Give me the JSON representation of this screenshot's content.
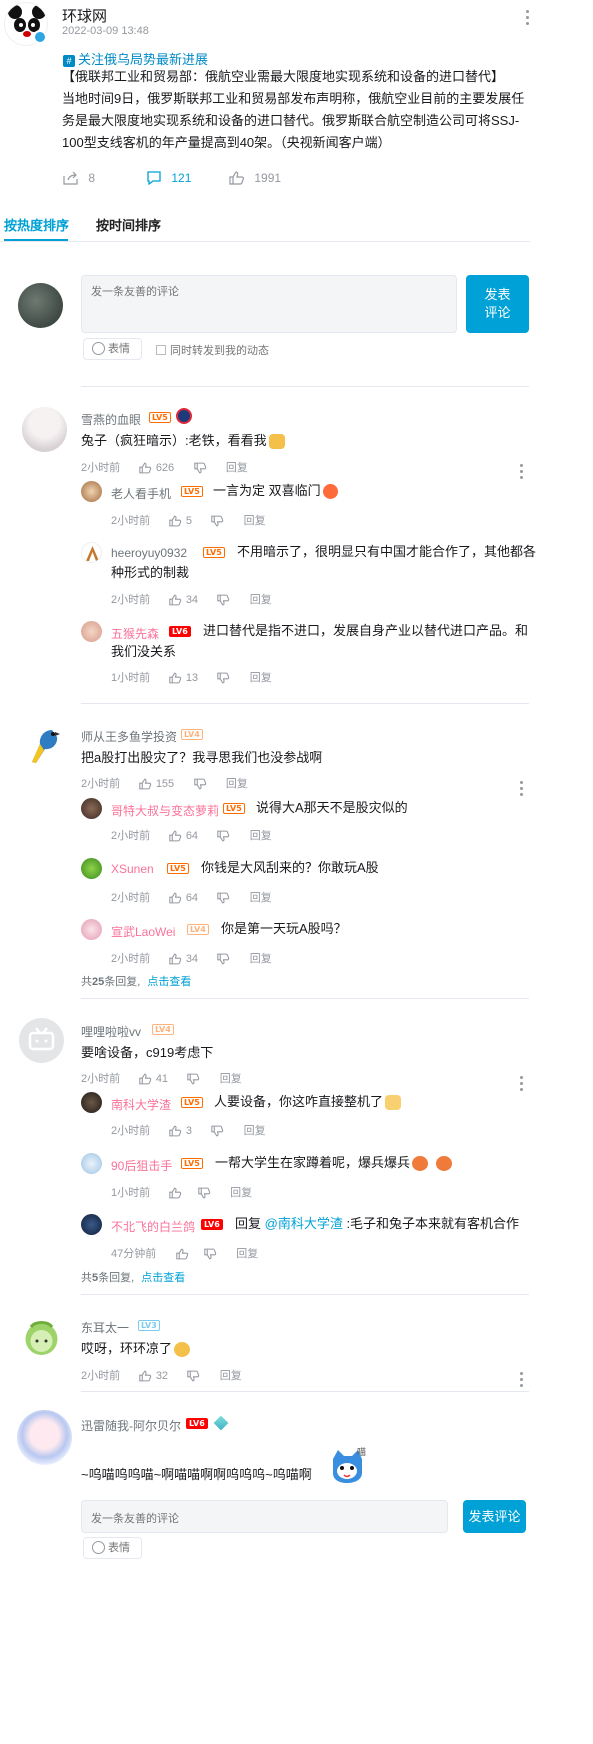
{
  "post": {
    "author": "环球网",
    "time": "2022-03-09 13:48",
    "topic": "关注俄乌局势最新进展",
    "body_line1": "【俄联邦工业和贸易部：俄航空业需最大限度地实现系统和设备的进口替代】",
    "body_line2": "当地时间9日，俄罗斯联邦工业和贸易部发布声明称，俄航空业目前的主要发展任",
    "body_line3": "务是最大限度地实现系统和设备的进口替代。俄罗斯联合航空制造公司可将SSJ-",
    "body_line4": "100型支线客机的年产量提高到40架。（央视新闻客户端）",
    "share_count": "8",
    "comment_count": "121",
    "like_count": "1991"
  },
  "tabs": {
    "hot": "按热度排序",
    "time": "按时间排序"
  },
  "composer": {
    "placeholder": "发一条友善的评论",
    "submit_line1": "发表",
    "submit_line2": "评论",
    "emoji": "表情",
    "forward": "同时转发到我的动态"
  },
  "bottom_composer": {
    "placeholder": "发一条友善的评论",
    "submit": "发表评论",
    "emoji": "表情"
  },
  "labels": {
    "reply": "回复",
    "view_more": "点击查看"
  },
  "comments": [
    {
      "user": "雪燕的血眼",
      "level": "LV5",
      "text": "兔子（疯狂暗示）:老铁，看看我",
      "time": "2小时前",
      "likes": "626",
      "replies": [
        {
          "user": "老人看手机",
          "level": "LV5",
          "text": "一言为定 双喜临门",
          "time": "2小时前",
          "likes": "5"
        },
        {
          "user": "heeroyuy0932",
          "level": "LV5",
          "text1": "不用暗示了，很明显只有中国才能合作了，其他都各",
          "text2": "种形式的制裁",
          "time": "2小时前",
          "likes": "34"
        },
        {
          "user": "五猴先森",
          "level": "LV6",
          "text1": "进口替代是指不进口，发展自身产业以替代进口产品。和",
          "text2": "我们没关系",
          "time": "1小时前",
          "likes": "13"
        }
      ]
    },
    {
      "user": "师从王多鱼学投资",
      "level": "LV4",
      "text": "把a股打出股灾了？我寻思我们也没参战啊",
      "time": "2小时前",
      "likes": "155",
      "replies": [
        {
          "user": "哥特大叔与变态萝莉",
          "level": "LV5",
          "text": "说得大A那天不是股灾似的",
          "time": "2小时前",
          "likes": "64"
        },
        {
          "user": "XSunen",
          "level": "LV5",
          "text": "你钱是大风刮来的？你敢玩A股",
          "time": "2小时前",
          "likes": "64"
        },
        {
          "user": "宣武LaoWei",
          "level": "LV4",
          "text": "你是第一天玩A股吗？",
          "time": "2小时前",
          "likes": "34"
        }
      ],
      "more_prefix": "共",
      "more_count": "25",
      "more_suffix": "条回复,"
    },
    {
      "user": "哩哩啦啦vv",
      "level": "LV4",
      "text": "要啥设备，c919考虑下",
      "time": "2小时前",
      "likes": "41",
      "replies": [
        {
          "user": "南科大学渣",
          "level": "LV5",
          "text": "人要设备，你这咋直接整机了",
          "time": "2小时前",
          "likes": "3"
        },
        {
          "user": "90后狙击手",
          "level": "LV5",
          "text": "一帮大学生在家蹲着呢，爆兵爆兵",
          "time": "1小时前",
          "likes": ""
        },
        {
          "user": "不北飞的白兰鸽",
          "level": "LV6",
          "text_pre": "回复 ",
          "mention": "@南科大学渣",
          "text_post": " :毛子和兔子本来就有客机合作",
          "time": "47分钟前",
          "likes": ""
        }
      ],
      "more_prefix": "共",
      "more_count": "5",
      "more_suffix": "条回复,"
    },
    {
      "user": "东耳太一",
      "level": "LV3",
      "text": "哎呀，环环凉了",
      "time": "2小时前",
      "likes": "32"
    },
    {
      "user": "迅雷随我-阿尔贝尔",
      "level": "LV6",
      "text": "~呜喵呜呜喵~啊喵喵啊啊呜呜呜~呜喵啊",
      "sticker_text": "喵"
    }
  ],
  "colors": {
    "accent": "#00a1d6",
    "vip_name": "#fb7299",
    "text": "#18191c",
    "muted": "#9499a0"
  }
}
